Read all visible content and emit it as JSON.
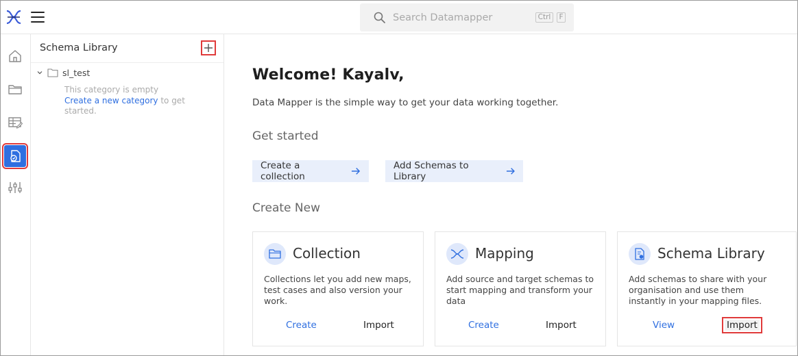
{
  "header": {
    "search_placeholder": "Search Datamapper",
    "shortcut_key1": "Ctrl",
    "shortcut_key2": "F"
  },
  "sidebar_panel": {
    "title": "Schema Library",
    "tree": [
      {
        "label": "sl_test",
        "expanded": true
      }
    ],
    "empty_text": "This category is empty",
    "create_link": "Create a new category",
    "create_suffix": " to get started."
  },
  "main": {
    "welcome": "Welcome! Kayalv,",
    "subtitle": "Data Mapper is the simple way to get your data working together.",
    "get_started_heading": "Get started",
    "get_started_buttons": [
      {
        "label": "Create a collection"
      },
      {
        "label": "Add Schemas to Library"
      }
    ],
    "create_new_heading": "Create New",
    "cards": [
      {
        "title": "Collection",
        "icon": "folder-icon",
        "description": "Collections let you add new maps, test cases and also version your work.",
        "primary": "Create",
        "secondary": "Import"
      },
      {
        "title": "Mapping",
        "icon": "mapping-icon",
        "description": "Add source and target schemas to start mapping and transform your data",
        "primary": "Create",
        "secondary": "Import"
      },
      {
        "title": "Schema Library",
        "icon": "schema-doc-icon",
        "description": "Add schemas to share with your organisation and use them instantly in your mapping files.",
        "primary": "View",
        "secondary": "Import"
      }
    ]
  },
  "colors": {
    "accent": "#2f6fe0",
    "highlight": "#e03a3a",
    "cta_bg": "#e9effb"
  }
}
